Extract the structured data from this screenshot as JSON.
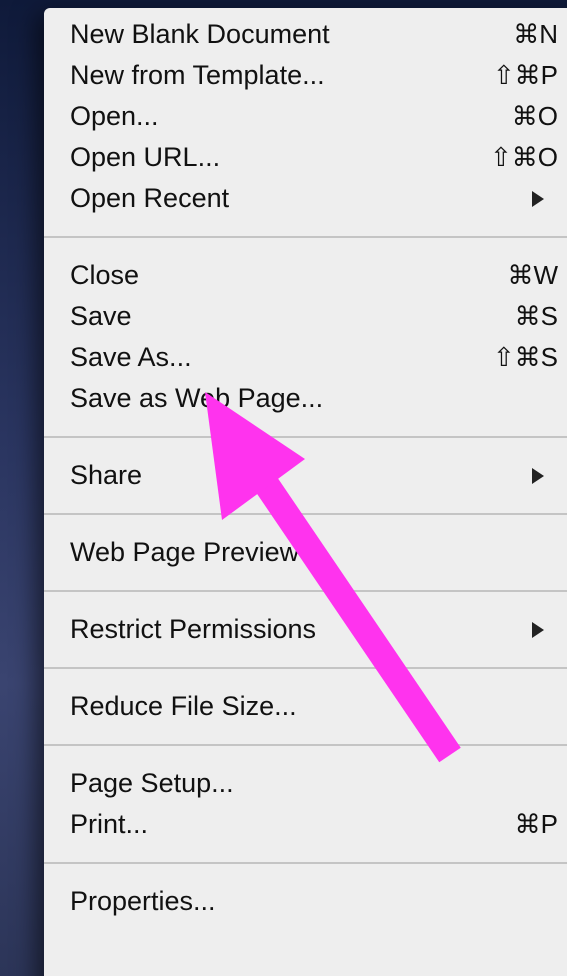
{
  "menu": {
    "groups": [
      [
        {
          "label": "New Blank Document",
          "shortcut": "⌘N"
        },
        {
          "label": "New from Template...",
          "shortcut": "⇧⌘P"
        },
        {
          "label": "Open...",
          "shortcut": "⌘O"
        },
        {
          "label": "Open URL...",
          "shortcut": "⇧⌘O"
        },
        {
          "label": "Open Recent",
          "shortcut": "",
          "submenu": true
        }
      ],
      [
        {
          "label": "Close",
          "shortcut": "⌘W"
        },
        {
          "label": "Save",
          "shortcut": "⌘S"
        },
        {
          "label": "Save As...",
          "shortcut": "⇧⌘S"
        },
        {
          "label": "Save as Web Page...",
          "shortcut": ""
        }
      ],
      [
        {
          "label": "Share",
          "shortcut": "",
          "submenu": true
        }
      ],
      [
        {
          "label": "Web Page Preview",
          "shortcut": ""
        }
      ],
      [
        {
          "label": "Restrict Permissions",
          "shortcut": "",
          "submenu": true
        }
      ],
      [
        {
          "label": "Reduce File Size...",
          "shortcut": ""
        }
      ],
      [
        {
          "label": "Page Setup...",
          "shortcut": ""
        },
        {
          "label": "Print...",
          "shortcut": "⌘P"
        }
      ],
      [
        {
          "label": "Properties...",
          "shortcut": ""
        }
      ]
    ]
  },
  "annotation": {
    "color": "#ff33ee",
    "icon": "pointer-arrow-icon"
  }
}
